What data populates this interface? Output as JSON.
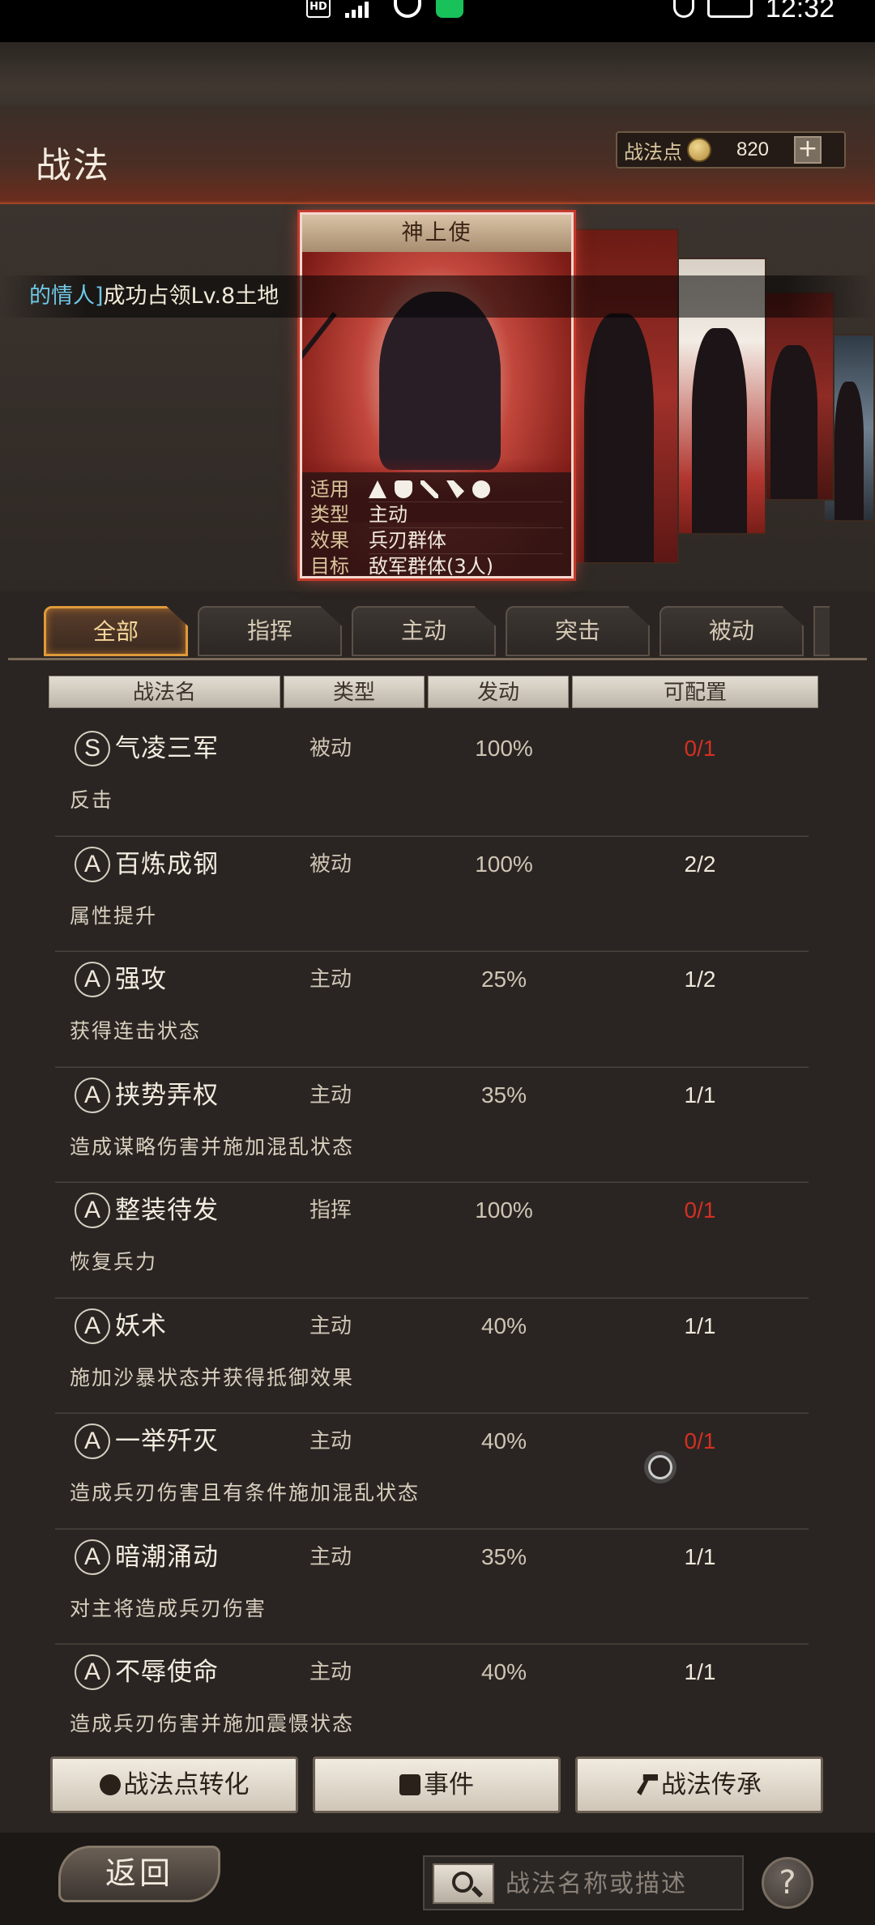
{
  "status_bar": {
    "time": "12:32",
    "hd": "HD"
  },
  "header": {
    "title": "战法",
    "points_label": "战法点",
    "points_value": "820",
    "add_label": "+"
  },
  "notice": {
    "highlight": "的情人]",
    "text": "成功占领Lv.8土地"
  },
  "featured_card": {
    "name": "神上使",
    "rows": [
      {
        "key": "适用",
        "value": ""
      },
      {
        "key": "类型",
        "value": "主动"
      },
      {
        "key": "效果",
        "value": "兵刃群体"
      },
      {
        "key": "目标",
        "value": "敌军群体(3人)"
      }
    ],
    "apply_icons": [
      "cavalry-icon",
      "shield-icon",
      "crossed-swords-icon",
      "archer-icon",
      "wheel-icon"
    ]
  },
  "tabs": [
    {
      "label": "全部",
      "active": true
    },
    {
      "label": "指挥",
      "active": false
    },
    {
      "label": "主动",
      "active": false
    },
    {
      "label": "突击",
      "active": false
    },
    {
      "label": "被动",
      "active": false
    }
  ],
  "table": {
    "headers": [
      "战法名",
      "类型",
      "发动",
      "可配置"
    ],
    "rows": [
      {
        "grade": "S",
        "name": "气凌三军",
        "type": "被动",
        "rate": "100%",
        "config": "0/1",
        "config_red": true,
        "desc": "反击"
      },
      {
        "grade": "A",
        "name": "百炼成钢",
        "type": "被动",
        "rate": "100%",
        "config": "2/2",
        "config_red": false,
        "desc": "属性提升"
      },
      {
        "grade": "A",
        "name": "强攻",
        "type": "主动",
        "rate": "25%",
        "config": "1/2",
        "config_red": false,
        "desc": "获得连击状态"
      },
      {
        "grade": "A",
        "name": "挟势弄权",
        "type": "主动",
        "rate": "35%",
        "config": "1/1",
        "config_red": false,
        "desc": "造成谋略伤害并施加混乱状态"
      },
      {
        "grade": "A",
        "name": "整装待发",
        "type": "指挥",
        "rate": "100%",
        "config": "0/1",
        "config_red": true,
        "desc": "恢复兵力"
      },
      {
        "grade": "A",
        "name": "妖术",
        "type": "主动",
        "rate": "40%",
        "config": "1/1",
        "config_red": false,
        "desc": "施加沙暴状态并获得抵御效果"
      },
      {
        "grade": "A",
        "name": "一举歼灭",
        "type": "主动",
        "rate": "40%",
        "config": "0/1",
        "config_red": true,
        "desc": "造成兵刃伤害且有条件施加混乱状态"
      },
      {
        "grade": "A",
        "name": "暗潮涌动",
        "type": "主动",
        "rate": "35%",
        "config": "1/1",
        "config_red": false,
        "desc": "对主将造成兵刃伤害"
      },
      {
        "grade": "A",
        "name": "不辱使命",
        "type": "主动",
        "rate": "40%",
        "config": "1/1",
        "config_red": false,
        "desc": "造成兵刃伤害并施加震慑状态"
      }
    ]
  },
  "buttons": {
    "convert": "战法点转化",
    "event": "事件",
    "inherit": "战法传承"
  },
  "footer": {
    "back": "返回",
    "search_placeholder": "战法名称或描述",
    "help": "?"
  },
  "colors": {
    "red_config": "#d23022",
    "tab_active_border": "#e09a3a"
  }
}
